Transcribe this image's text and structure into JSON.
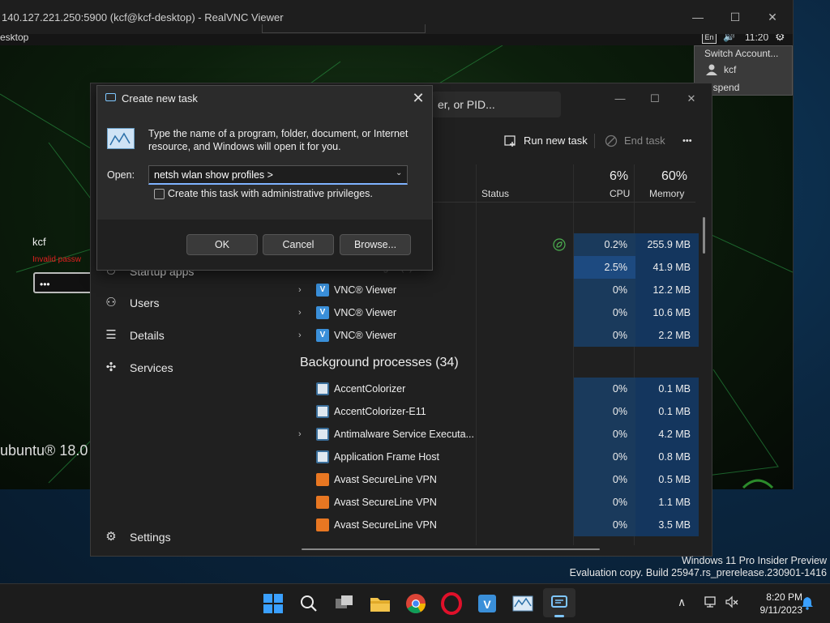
{
  "vnc": {
    "title": "140.127.221.250:5900 (kcf@kcf-desktop) - RealVNC Viewer",
    "minimize": "—",
    "maximize": "☐",
    "close": "✕"
  },
  "ubuntu": {
    "desktop_label": "esktop",
    "tray": {
      "lang": "En",
      "volume": "🔊",
      "time": "11:20",
      "gear": "⚙"
    },
    "user_menu": {
      "switch": "Switch Account...",
      "user": "kcf",
      "suspend": "uspend"
    },
    "login": {
      "user": "kcf",
      "error": "Invalid passw",
      "password_mask": "•••"
    },
    "logo": "ubuntu® 18.0"
  },
  "task_manager": {
    "search_placeholder": "er, or PID...",
    "controls": {
      "min": "—",
      "max": "☐",
      "close": "✕"
    },
    "toolbar": {
      "run_new_task": "Run new task",
      "end_task": "End task",
      "more": "•••"
    },
    "nav": {
      "startup": "Startup apps",
      "users": "Users",
      "details": "Details",
      "services": "Services",
      "settings": "Settings"
    },
    "columns": {
      "status": "Status",
      "cpu_pct": "6%",
      "cpu": "CPU",
      "mem_pct": "60%",
      "memory": "Memory"
    },
    "apps_rows": [
      {
        "name": "",
        "cpu": "0.2%",
        "mem": "255.9 MB",
        "expand": ""
      },
      {
        "name": "Task Manager (3)",
        "cpu": "2.5%",
        "mem": "41.9 MB",
        "expand": ""
      },
      {
        "name": "VNC® Viewer",
        "cpu": "0%",
        "mem": "12.2 MB",
        "expand": "›"
      },
      {
        "name": "VNC® Viewer",
        "cpu": "0%",
        "mem": "10.6 MB",
        "expand": "›"
      },
      {
        "name": "VNC® Viewer",
        "cpu": "0%",
        "mem": "2.2 MB",
        "expand": "›"
      }
    ],
    "bg_header": "Background processes (34)",
    "bg_rows": [
      {
        "name": "AccentColorizer",
        "cpu": "0%",
        "mem": "0.1 MB",
        "expand": ""
      },
      {
        "name": "AccentColorizer-E11",
        "cpu": "0%",
        "mem": "0.1 MB",
        "expand": ""
      },
      {
        "name": "Antimalware Service Executa...",
        "cpu": "0%",
        "mem": "4.2 MB",
        "expand": "›"
      },
      {
        "name": "Application Frame Host",
        "cpu": "0%",
        "mem": "0.8 MB",
        "expand": ""
      },
      {
        "name": "Avast SecureLine VPN",
        "cpu": "0%",
        "mem": "0.5 MB",
        "expand": ""
      },
      {
        "name": "Avast SecureLine VPN",
        "cpu": "0%",
        "mem": "1.1 MB",
        "expand": ""
      },
      {
        "name": "Avast SecureLine VPN",
        "cpu": "0%",
        "mem": "3.5 MB",
        "expand": ""
      }
    ]
  },
  "run_dialog": {
    "title": "Create new task",
    "close": "✕",
    "description": "Type the name of a program, folder, document, or Internet resource, and Windows will open it for you.",
    "open_label": "Open:",
    "input_value": "netsh wlan show profiles >",
    "checkbox_label": "Create this task with administrative privileges.",
    "ok": "OK",
    "cancel": "Cancel",
    "browse": "Browse..."
  },
  "watermark": {
    "line1": "Windows 11 Pro Insider Preview",
    "line2": "Evaluation copy. Build 25947.rs_prerelease.230901-1416"
  },
  "taskbar": {
    "chevron": "∧",
    "time": "8:20 PM",
    "date": "9/11/2023"
  }
}
